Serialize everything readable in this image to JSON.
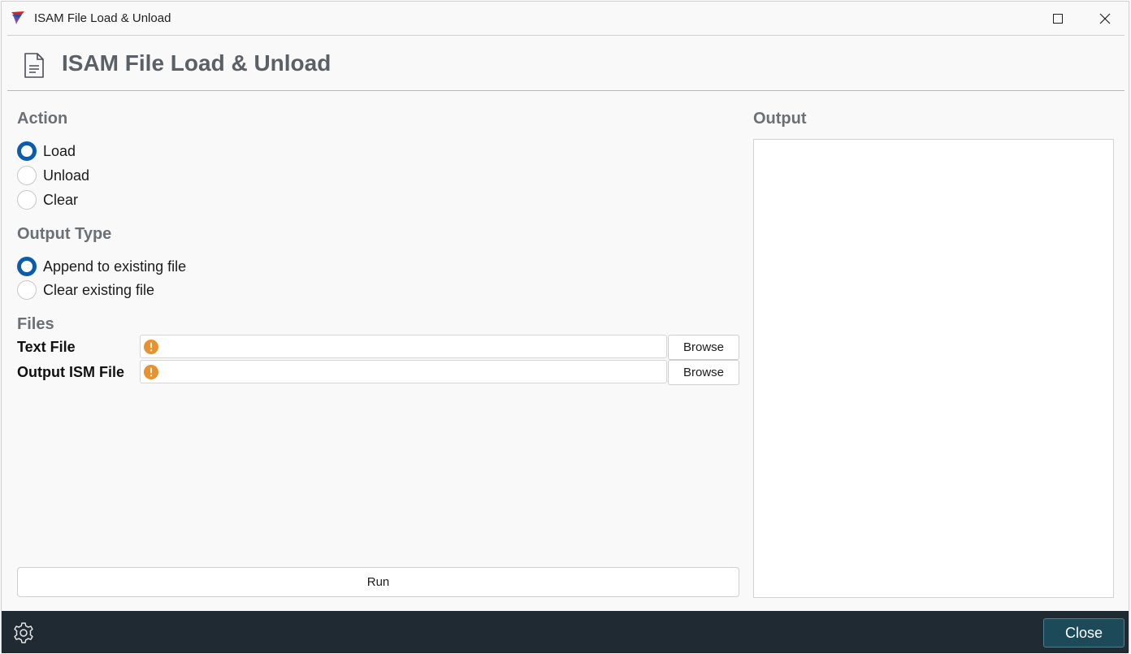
{
  "window": {
    "title": "ISAM File Load & Unload"
  },
  "header": {
    "title": "ISAM File Load & Unload",
    "icon": "document-icon"
  },
  "action": {
    "label": "Action",
    "options": [
      {
        "label": "Load",
        "checked": true
      },
      {
        "label": "Unload",
        "checked": false
      },
      {
        "label": "Clear",
        "checked": false
      }
    ]
  },
  "output_type": {
    "label": "Output Type",
    "options": [
      {
        "label": "Append to existing file",
        "checked": true
      },
      {
        "label": "Clear existing file",
        "checked": false
      }
    ]
  },
  "files": {
    "label": "Files",
    "rows": [
      {
        "label": "Text File",
        "value": "",
        "browse_label": "Browse"
      },
      {
        "label": "Output ISM File",
        "value": "",
        "browse_label": "Browse"
      }
    ]
  },
  "run": {
    "label": "Run"
  },
  "output": {
    "label": "Output",
    "value": ""
  },
  "footer": {
    "close_label": "Close"
  },
  "colors": {
    "accent": "#0b5cad",
    "warning": "#e8912d",
    "footer_bg": "#202a33",
    "close_bg": "#1c4a59"
  }
}
